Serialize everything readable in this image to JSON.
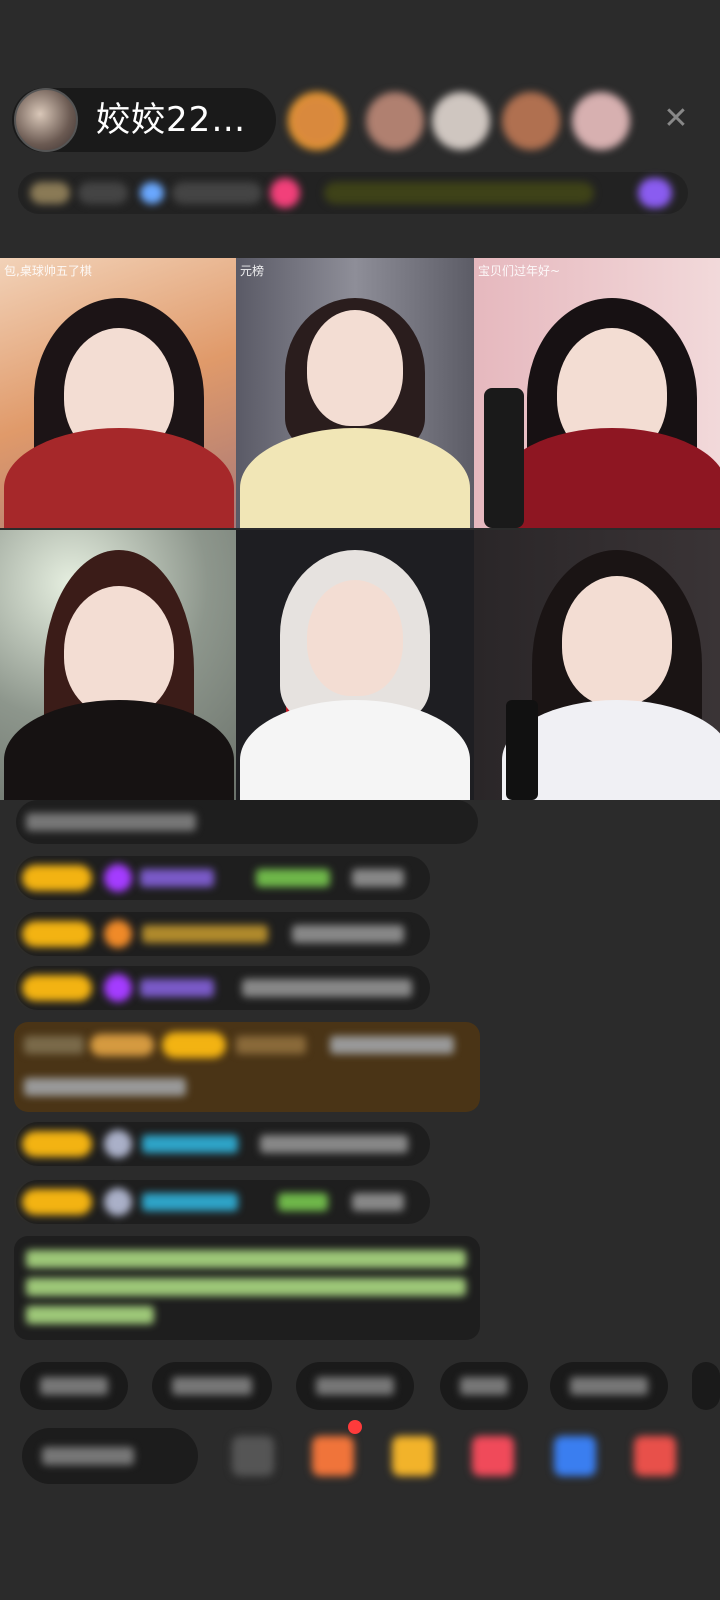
{
  "header": {
    "host_name": "姣姣22…",
    "close_glyph": "✕",
    "viewer_colors": [
      "#d9893d",
      "#b08070",
      "#cfc6c0",
      "#b07050",
      "#d7b0b0"
    ]
  },
  "info_bar": {
    "accent_pink": "#f2407a",
    "accent_purple": "#8a5cf0",
    "accent_yellow": "#b9c62a"
  },
  "grid": {
    "tiles": [
      {
        "caption": "包,桌球帅五了棋",
        "bg": "#e8b48a",
        "hair": "#1c1416",
        "body": "#a6282a"
      },
      {
        "caption": "元榜",
        "bg": "#6b6b78",
        "hair": "#2a1d1d",
        "body": "#f1e6b6"
      },
      {
        "caption": "宝贝们过年好~",
        "bg": "#e9c4c8",
        "hair": "#171113",
        "body": "#8e1622"
      },
      {
        "caption": "",
        "bg": "#9aa09a",
        "hair": "#3b1c18",
        "body": "#161212"
      },
      {
        "caption": "",
        "bg": "#1e1e22",
        "hair": "#e6e2df",
        "body": "#f5f5f5"
      },
      {
        "caption": "",
        "bg": "#2a2628",
        "hair": "#1a1414",
        "body": "#f0f0f4"
      }
    ]
  },
  "colors": {
    "badge_yellow": "#f3b312",
    "gem_purple": "#a43cff",
    "gem_orange": "#f08a28",
    "name_purple": "#7a5ac8",
    "name_gold": "#b08a2c",
    "name_teal": "#2ea3c7",
    "green_text": "#6fb84a",
    "highlight_bg": "#4a3416",
    "system_green": "#9ec878"
  }
}
